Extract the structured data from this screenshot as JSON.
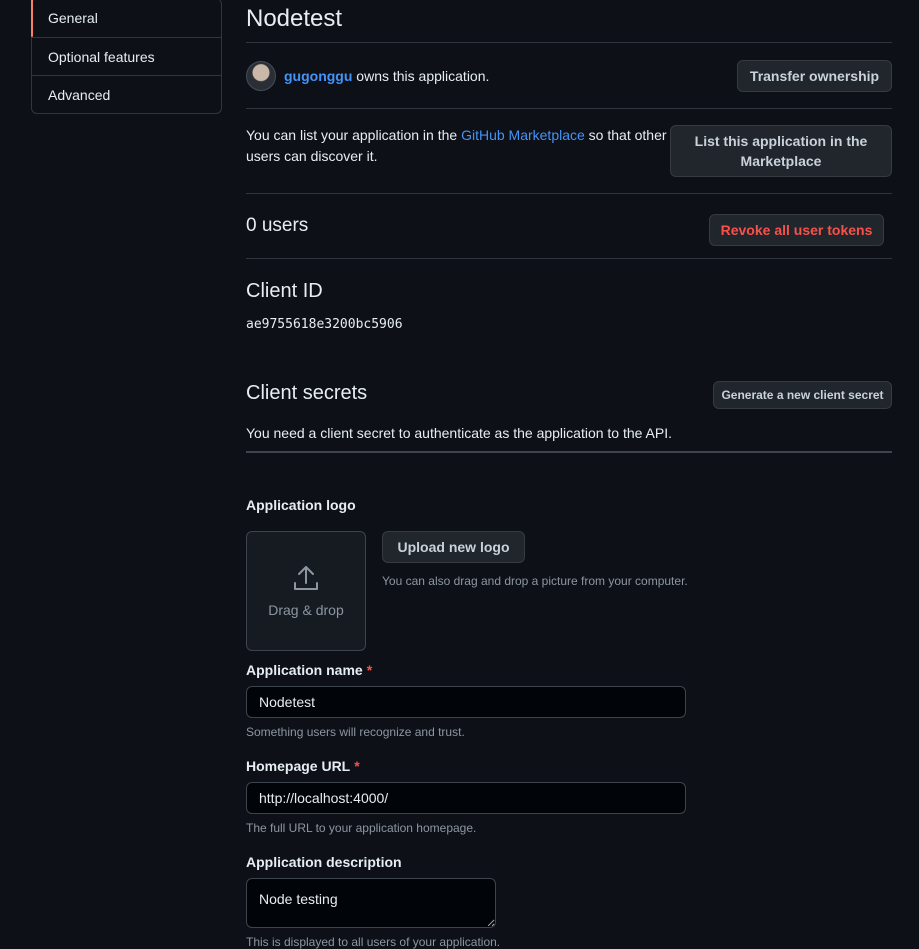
{
  "sidebar": {
    "items": [
      {
        "label": "General"
      },
      {
        "label": "Optional features"
      },
      {
        "label": "Advanced"
      }
    ]
  },
  "app": {
    "title": "Nodetest",
    "owner_name": "gugonggu",
    "owner_suffix": " owns this application.",
    "transfer_button": "Transfer ownership"
  },
  "marketplace": {
    "text_before": "You can list your application in the ",
    "link": "GitHub Marketplace",
    "text_after": " so that other users can discover it.",
    "button": "List this application in the Marketplace"
  },
  "users": {
    "count_label": "0 users",
    "revoke_button": "Revoke all user tokens"
  },
  "client_id": {
    "heading": "Client ID",
    "value": "ae9755618e3200bc5906"
  },
  "client_secrets": {
    "heading": "Client secrets",
    "button": "Generate a new client secret",
    "description": "You need a client secret to authenticate as the application to the API."
  },
  "logo": {
    "label": "Application logo",
    "dropzone_text": "Drag & drop",
    "upload_button": "Upload new logo",
    "note": "You can also drag and drop a picture from your computer."
  },
  "form": {
    "name_label": "Application name",
    "name_value": "Nodetest",
    "name_note": "Something users will recognize and trust.",
    "homepage_label": "Homepage URL",
    "homepage_value": "http://localhost:4000/",
    "homepage_note": "The full URL to your application homepage.",
    "description_label": "Application description",
    "description_value": "Node testing",
    "description_note": "This is displayed to all users of your application."
  },
  "colors": {
    "background": "#0d1117",
    "accent": "#4493f8",
    "danger": "#f85149",
    "active_tab": "#f78166"
  }
}
